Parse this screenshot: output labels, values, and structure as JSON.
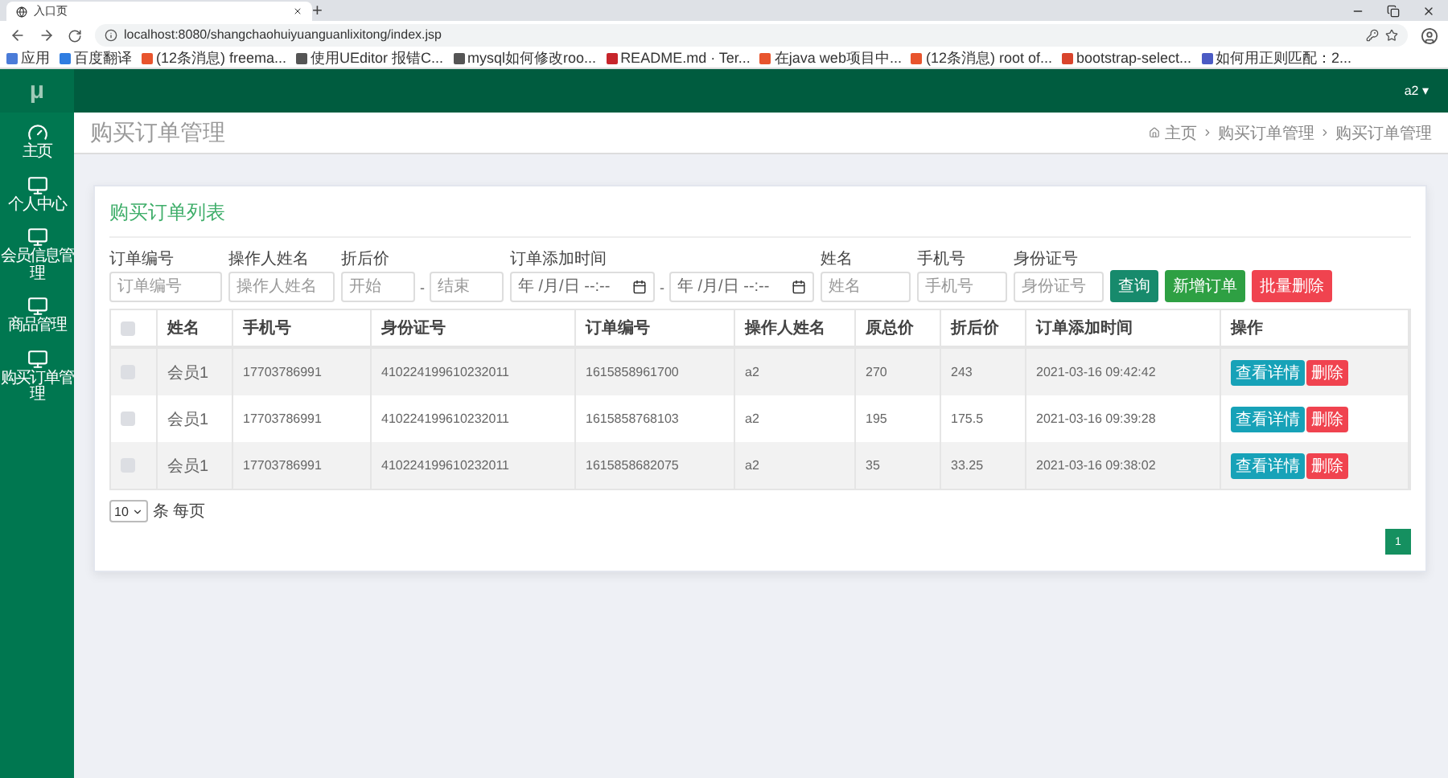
{
  "browser": {
    "tab_title": "入口页",
    "new_tab": "+",
    "url": "localhost:8080/shangchaohuiyuanguanlixitong/index.jsp",
    "bookmarks": [
      {
        "label": "应用",
        "color": "#4a7bd8"
      },
      {
        "label": "百度翻译",
        "color": "#2f7de1"
      },
      {
        "label": "(12条消息) freema...",
        "color": "#e8542d"
      },
      {
        "label": "使用UEditor 报错C...",
        "color": "#555555"
      },
      {
        "label": "mysql如何修改roo...",
        "color": "#555555"
      },
      {
        "label": "README.md · Ter...",
        "color": "#c7252b"
      },
      {
        "label": "在java web项目中...",
        "color": "#e8542d"
      },
      {
        "label": "(12条消息) root of...",
        "color": "#e8542d"
      },
      {
        "label": "bootstrap-select...",
        "color": "#d9442c"
      },
      {
        "label": "如何用正则匹配：2...",
        "color": "#4b5bc4"
      }
    ]
  },
  "app": {
    "logo": "μ",
    "user": "a2 ▾"
  },
  "sidebar": {
    "items": [
      {
        "label": "主页",
        "kind": "dashboard"
      },
      {
        "label": "个人中心",
        "kind": "monitor"
      },
      {
        "label": "会员信息管理",
        "kind": "monitor"
      },
      {
        "label": "商品管理",
        "kind": "monitor"
      },
      {
        "label": "购买订单管理",
        "kind": "monitor"
      }
    ]
  },
  "page": {
    "title": "购买订单管理",
    "breadcrumb": [
      "主页",
      "购买订单管理",
      "购买订单管理"
    ]
  },
  "card": {
    "title": "购买订单列表",
    "filters": [
      {
        "label": "订单编号",
        "kind": "text",
        "fields": [
          {
            "placeholder": "订单编号"
          }
        ]
      },
      {
        "label": "操作人姓名",
        "kind": "text",
        "fields": [
          {
            "placeholder": "操作人姓名"
          }
        ]
      },
      {
        "label": "折后价",
        "kind": "range",
        "fields": [
          {
            "placeholder": "开始"
          },
          {
            "placeholder": "结束"
          }
        ],
        "separator": "-"
      },
      {
        "label": "订单添加时间",
        "kind": "date",
        "fields": [
          {
            "value": "年 /月/日 --:--"
          },
          {
            "value": "年 /月/日 --:--"
          }
        ],
        "separator": "-"
      },
      {
        "label": "姓名",
        "kind": "text",
        "fields": [
          {
            "placeholder": "姓名"
          }
        ]
      },
      {
        "label": "手机号",
        "kind": "text",
        "fields": [
          {
            "placeholder": "手机号"
          }
        ]
      },
      {
        "label": "身份证号",
        "kind": "text",
        "fields": [
          {
            "placeholder": "身份证号"
          }
        ]
      }
    ],
    "buttons": [
      {
        "label": "查询",
        "kind": "search"
      },
      {
        "label": "新增订单",
        "kind": "add"
      },
      {
        "label": "批量删除",
        "kind": "delete"
      }
    ],
    "table": {
      "all_checked": false,
      "columns": [
        "姓名",
        "手机号",
        "身份证号",
        "订单编号",
        "操作人姓名",
        "原总价",
        "折后价",
        "订单添加时间",
        "操作"
      ],
      "rows": [
        {
          "checked": false,
          "cells": [
            "会员1",
            "17703786991",
            "410224199610232011",
            "1615858961700",
            "a2",
            "270",
            "243",
            "2021-03-16 09:42:42"
          ],
          "actions": [
            "查看详情",
            "删除"
          ]
        },
        {
          "checked": false,
          "cells": [
            "会员1",
            "17703786991",
            "410224199610232011",
            "1615858768103",
            "a2",
            "195",
            "175.5",
            "2021-03-16 09:39:28"
          ],
          "actions": [
            "查看详情",
            "删除"
          ]
        },
        {
          "checked": false,
          "cells": [
            "会员1",
            "17703786991",
            "410224199610232011",
            "1615858682075",
            "a2",
            "35",
            "33.25",
            "2021-03-16 09:38:02"
          ],
          "actions": [
            "查看详情",
            "删除"
          ]
        }
      ]
    },
    "page_size": "10",
    "page_size_suffix": "条 每页",
    "pages": [
      {
        "label": "1",
        "selected": true
      }
    ]
  }
}
